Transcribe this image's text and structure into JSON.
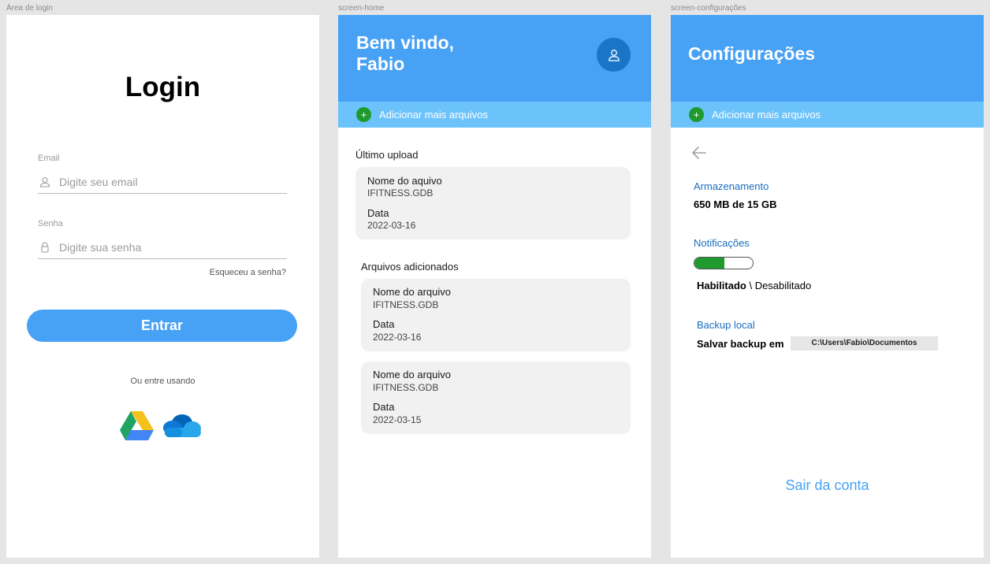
{
  "frames": {
    "login_label": "Área de login",
    "home_label": "screen-home",
    "config_label": "screen-configurações"
  },
  "login": {
    "title": "Login",
    "email_label": "Email",
    "email_placeholder": "Digite seu email",
    "password_label": "Senha",
    "password_placeholder": "Digite sua senha",
    "forgot": "Esqueceu a senha?",
    "enter_button": "Entrar",
    "or_text": "Ou entre usando",
    "providers": [
      "google-drive-icon",
      "onedrive-icon"
    ]
  },
  "home": {
    "welcome": "Bem vindo,",
    "user_name": "Fabio",
    "add_files": "Adicionar mais arquivos",
    "last_upload_title": "Último upload",
    "last_upload": {
      "name_label": "Nome do aquivo",
      "name_value": "IFITNESS.GDB",
      "date_label": "Data",
      "date_value": "2022-03-16"
    },
    "added_title": "Arquivos adicionados",
    "added_files": [
      {
        "name_label": "Nome do arquivo",
        "name_value": "IFITNESS.GDB",
        "date_label": "Data",
        "date_value": "2022-03-16"
      },
      {
        "name_label": "Nome do arquivo",
        "name_value": "IFITNESS.GDB",
        "date_label": "Data",
        "date_value": "2022-03-15"
      }
    ]
  },
  "config": {
    "title": "Configurações",
    "add_files": "Adicionar mais arquivos",
    "storage_label": "Armazenamento",
    "storage_value": "650 MB de 15 GB",
    "notifications_label": "Notificações",
    "notifications_enabled": true,
    "enabled_text": "Habilitado",
    "separator": " \\ ",
    "disabled_text": "Desabilitado",
    "backup_label": "Backup local",
    "backup_save_label": "Salvar backup em",
    "backup_path": "C:\\Users\\Fabio\\Documentos",
    "logout": "Sair da conta"
  },
  "colors": {
    "primary": "#47a1f5",
    "primary_dark": "#1a74c8",
    "add_bar": "#6cc3fc",
    "plus_green": "#1f9a2e",
    "label_blue": "#1a6fbd"
  }
}
